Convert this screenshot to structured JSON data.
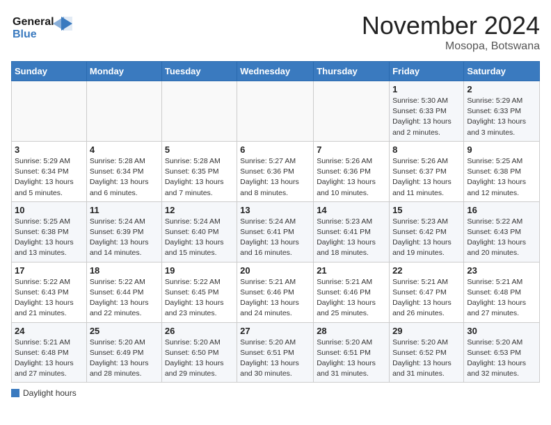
{
  "header": {
    "logo_line1": "General",
    "logo_line2": "Blue",
    "month": "November 2024",
    "location": "Mosopa, Botswana"
  },
  "calendar": {
    "weekdays": [
      "Sunday",
      "Monday",
      "Tuesday",
      "Wednesday",
      "Thursday",
      "Friday",
      "Saturday"
    ],
    "weeks": [
      [
        {
          "day": "",
          "detail": ""
        },
        {
          "day": "",
          "detail": ""
        },
        {
          "day": "",
          "detail": ""
        },
        {
          "day": "",
          "detail": ""
        },
        {
          "day": "",
          "detail": ""
        },
        {
          "day": "1",
          "detail": "Sunrise: 5:30 AM\nSunset: 6:33 PM\nDaylight: 13 hours\nand 2 minutes."
        },
        {
          "day": "2",
          "detail": "Sunrise: 5:29 AM\nSunset: 6:33 PM\nDaylight: 13 hours\nand 3 minutes."
        }
      ],
      [
        {
          "day": "3",
          "detail": "Sunrise: 5:29 AM\nSunset: 6:34 PM\nDaylight: 13 hours\nand 5 minutes."
        },
        {
          "day": "4",
          "detail": "Sunrise: 5:28 AM\nSunset: 6:34 PM\nDaylight: 13 hours\nand 6 minutes."
        },
        {
          "day": "5",
          "detail": "Sunrise: 5:28 AM\nSunset: 6:35 PM\nDaylight: 13 hours\nand 7 minutes."
        },
        {
          "day": "6",
          "detail": "Sunrise: 5:27 AM\nSunset: 6:36 PM\nDaylight: 13 hours\nand 8 minutes."
        },
        {
          "day": "7",
          "detail": "Sunrise: 5:26 AM\nSunset: 6:36 PM\nDaylight: 13 hours\nand 10 minutes."
        },
        {
          "day": "8",
          "detail": "Sunrise: 5:26 AM\nSunset: 6:37 PM\nDaylight: 13 hours\nand 11 minutes."
        },
        {
          "day": "9",
          "detail": "Sunrise: 5:25 AM\nSunset: 6:38 PM\nDaylight: 13 hours\nand 12 minutes."
        }
      ],
      [
        {
          "day": "10",
          "detail": "Sunrise: 5:25 AM\nSunset: 6:38 PM\nDaylight: 13 hours\nand 13 minutes."
        },
        {
          "day": "11",
          "detail": "Sunrise: 5:24 AM\nSunset: 6:39 PM\nDaylight: 13 hours\nand 14 minutes."
        },
        {
          "day": "12",
          "detail": "Sunrise: 5:24 AM\nSunset: 6:40 PM\nDaylight: 13 hours\nand 15 minutes."
        },
        {
          "day": "13",
          "detail": "Sunrise: 5:24 AM\nSunset: 6:41 PM\nDaylight: 13 hours\nand 16 minutes."
        },
        {
          "day": "14",
          "detail": "Sunrise: 5:23 AM\nSunset: 6:41 PM\nDaylight: 13 hours\nand 18 minutes."
        },
        {
          "day": "15",
          "detail": "Sunrise: 5:23 AM\nSunset: 6:42 PM\nDaylight: 13 hours\nand 19 minutes."
        },
        {
          "day": "16",
          "detail": "Sunrise: 5:22 AM\nSunset: 6:43 PM\nDaylight: 13 hours\nand 20 minutes."
        }
      ],
      [
        {
          "day": "17",
          "detail": "Sunrise: 5:22 AM\nSunset: 6:43 PM\nDaylight: 13 hours\nand 21 minutes."
        },
        {
          "day": "18",
          "detail": "Sunrise: 5:22 AM\nSunset: 6:44 PM\nDaylight: 13 hours\nand 22 minutes."
        },
        {
          "day": "19",
          "detail": "Sunrise: 5:22 AM\nSunset: 6:45 PM\nDaylight: 13 hours\nand 23 minutes."
        },
        {
          "day": "20",
          "detail": "Sunrise: 5:21 AM\nSunset: 6:46 PM\nDaylight: 13 hours\nand 24 minutes."
        },
        {
          "day": "21",
          "detail": "Sunrise: 5:21 AM\nSunset: 6:46 PM\nDaylight: 13 hours\nand 25 minutes."
        },
        {
          "day": "22",
          "detail": "Sunrise: 5:21 AM\nSunset: 6:47 PM\nDaylight: 13 hours\nand 26 minutes."
        },
        {
          "day": "23",
          "detail": "Sunrise: 5:21 AM\nSunset: 6:48 PM\nDaylight: 13 hours\nand 27 minutes."
        }
      ],
      [
        {
          "day": "24",
          "detail": "Sunrise: 5:21 AM\nSunset: 6:48 PM\nDaylight: 13 hours\nand 27 minutes."
        },
        {
          "day": "25",
          "detail": "Sunrise: 5:20 AM\nSunset: 6:49 PM\nDaylight: 13 hours\nand 28 minutes."
        },
        {
          "day": "26",
          "detail": "Sunrise: 5:20 AM\nSunset: 6:50 PM\nDaylight: 13 hours\nand 29 minutes."
        },
        {
          "day": "27",
          "detail": "Sunrise: 5:20 AM\nSunset: 6:51 PM\nDaylight: 13 hours\nand 30 minutes."
        },
        {
          "day": "28",
          "detail": "Sunrise: 5:20 AM\nSunset: 6:51 PM\nDaylight: 13 hours\nand 31 minutes."
        },
        {
          "day": "29",
          "detail": "Sunrise: 5:20 AM\nSunset: 6:52 PM\nDaylight: 13 hours\nand 31 minutes."
        },
        {
          "day": "30",
          "detail": "Sunrise: 5:20 AM\nSunset: 6:53 PM\nDaylight: 13 hours\nand 32 minutes."
        }
      ]
    ]
  },
  "legend": {
    "daylight_label": "Daylight hours"
  }
}
